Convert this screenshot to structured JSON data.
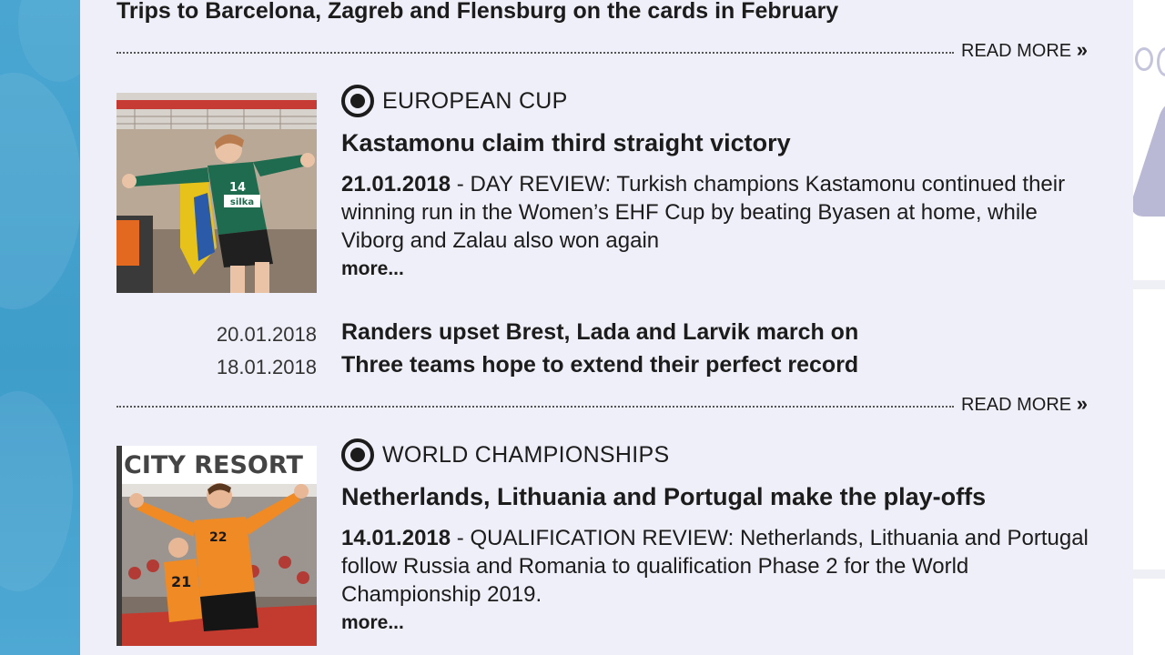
{
  "intro": {
    "teaser": "Trips to Barcelona, Zagreb and Flensburg on the cards in February",
    "read_more": "READ MORE",
    "arrow": "»"
  },
  "articles": [
    {
      "section": "EUROPEAN CUP",
      "headline": "Kastamonu claim third straight victory",
      "date": "21.01.2018",
      "summary": " - DAY REVIEW: Turkish champions Kastamonu continued their winning run in the Women’s EHF Cup by beating Byasen at home, while Viborg and Zalau also won again",
      "more": "more...",
      "image": {
        "alt": "handball-player-celebrating",
        "jersey_number": "14",
        "sponsor": "silka"
      },
      "related": [
        {
          "date": "20.01.2018",
          "title": "Randers upset Brest, Lada and Larvik march on"
        },
        {
          "date": "18.01.2018",
          "title": "Three teams hope to extend their perfect record"
        }
      ],
      "read_more": "READ MORE",
      "arrow": "»"
    },
    {
      "section": "WORLD CHAMPIONSHIPS",
      "headline": "Netherlands, Lithuania and Portugal make the play-offs",
      "date": "14.01.2018",
      "summary": " - QUALIFICATION REVIEW: Netherlands, Lithuania and Portugal follow Russia and Romania to qualification Phase 2 for the World Championship 2019.",
      "more": "more...",
      "image": {
        "alt": "netherlands-players-celebrating",
        "banner_text": "CITY RESORT",
        "jersey_number": "21"
      }
    }
  ],
  "colors": {
    "content_bg": "#efeff9",
    "page_bg_left": "#4aa3cf",
    "text": "#1c1c1c",
    "netherlands_orange": "#f08a24",
    "kastamonu_green": "#1f6b4f"
  }
}
